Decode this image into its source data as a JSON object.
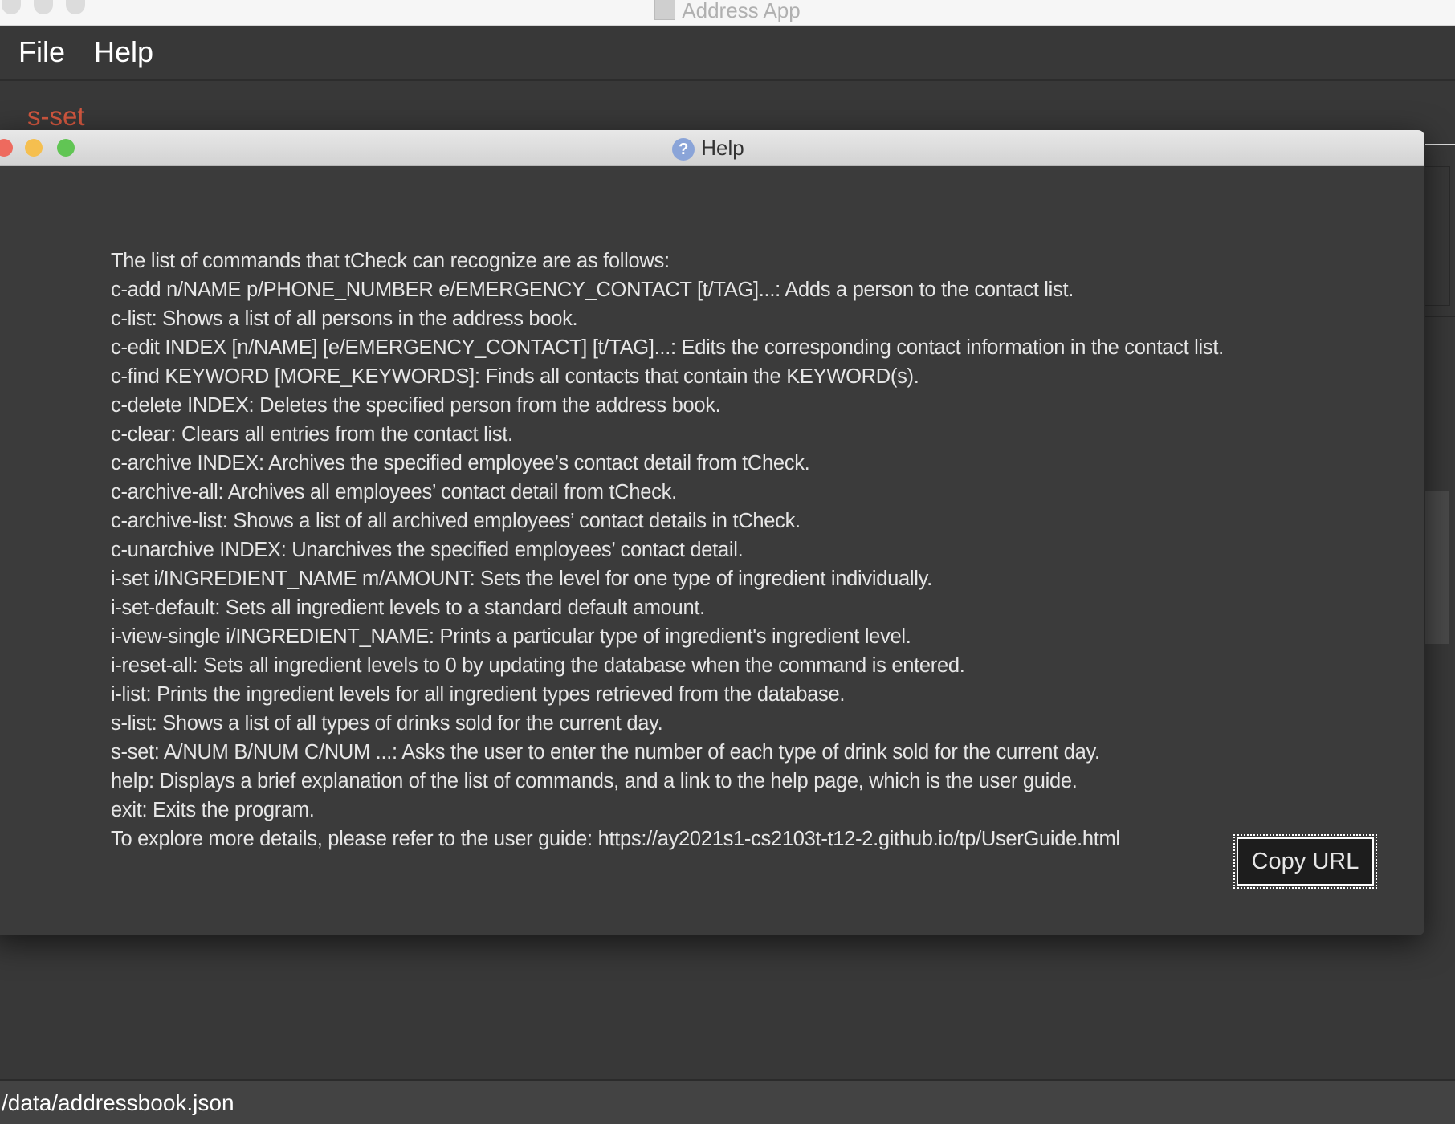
{
  "main_window": {
    "title": "Address App",
    "menu": [
      "File",
      "Help"
    ],
    "command_echo": "s-set",
    "status_path": "/data/addressbook.json"
  },
  "help_window": {
    "title": "Help",
    "lines": [
      "The list of commands that tCheck can recognize are as follows:",
      "c-add n/NAME p/PHONE_NUMBER e/EMERGENCY_CONTACT [t/TAG]...: Adds a person to the contact list.",
      "c-list: Shows a list of all persons in the address book.",
      "c-edit INDEX [n/NAME] [e/EMERGENCY_CONTACT] [t/TAG]...: Edits the corresponding contact information in the contact list.",
      "c-find KEYWORD [MORE_KEYWORDS]: Finds all contacts that contain the KEYWORD(s).",
      "c-delete INDEX: Deletes the specified person from the address book.",
      "c-clear: Clears all entries from the contact list.",
      "c-archive INDEX: Archives the specified employee’s contact detail from tCheck.",
      "c-archive-all: Archives all employees’ contact detail from tCheck.",
      "c-archive-list: Shows a list of all archived employees’ contact details in tCheck.",
      "c-unarchive INDEX: Unarchives the specified employees’ contact detail.",
      "i-set i/INGREDIENT_NAME m/AMOUNT: Sets the level for one type of ingredient individually.",
      "i-set-default: Sets all ingredient levels to a standard default amount.",
      "i-view-single i/INGREDIENT_NAME: Prints a particular type of ingredient's ingredient level.",
      "i-reset-all: Sets all ingredient levels to 0 by updating the database when the command is entered.",
      "i-list: Prints the ingredient levels for all ingredient types retrieved from the database.",
      "s-list: Shows a list of all types of drinks sold for the current day.",
      "s-set: A/NUM B/NUM C/NUM ...: Asks the user to enter the number of each type of drink sold for the current day.",
      "help: Displays a brief explanation of the list of commands, and a link to the help page, which is the user guide.",
      "exit: Exits the program.",
      "To explore more details, please refer to the user guide: https://ay2021s1-cs2103t-t12-2.github.io/tp/UserGuide.html"
    ],
    "copy_button": "Copy URL"
  },
  "colors": {
    "accent_command": "#d2573f",
    "close": "#ee6a5e",
    "minimize": "#f5bf4f",
    "zoom": "#61c554"
  }
}
